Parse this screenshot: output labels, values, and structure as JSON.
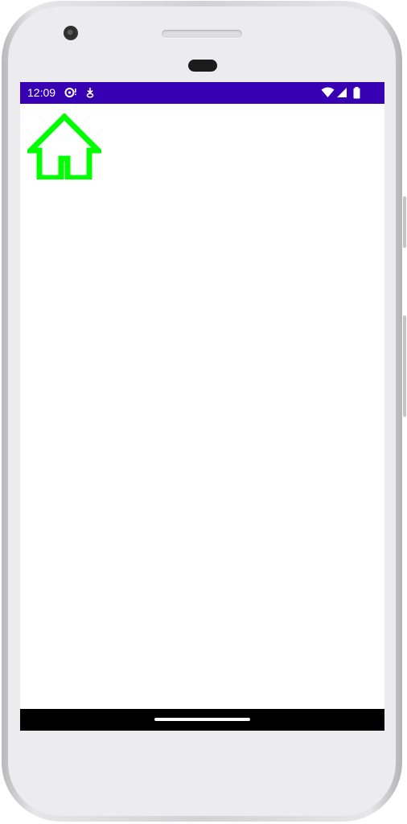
{
  "status_bar": {
    "time": "12:09",
    "background_color": "#3700b3",
    "icons": [
      "sync-icon",
      "download-icon",
      "wifi-icon",
      "signal-icon",
      "battery-icon"
    ]
  },
  "content": {
    "home_button_icon": "home-icon",
    "home_icon_color": "#00ff00"
  },
  "nav_bar": {
    "background_color": "#000000",
    "gesture_handle": "home-indicator"
  }
}
